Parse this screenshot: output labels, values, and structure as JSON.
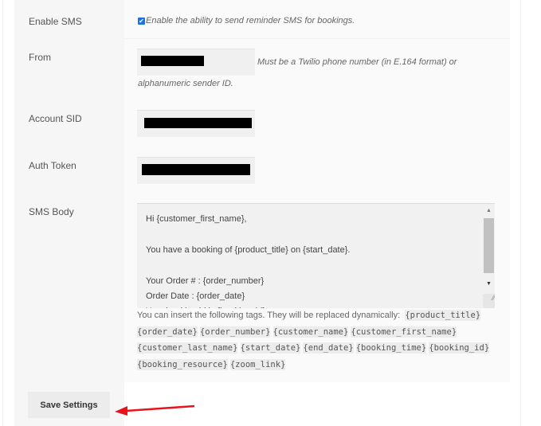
{
  "enable_sms": {
    "label": "Enable SMS",
    "checked": true,
    "description": "Enable the ability to send reminder SMS for bookings."
  },
  "from": {
    "label": "From",
    "hint_line1": "Must be a Twilio phone number (in E.164 format) or",
    "hint_line2": "alphanumeric sender ID."
  },
  "account_sid": {
    "label": "Account SID"
  },
  "auth_token": {
    "label": "Auth Token"
  },
  "sms_body": {
    "label": "SMS Body",
    "value": "Hi {customer_first_name},\n\nYou have a booking of {product_title} on {start_date}.\n\nYour Order # : {order_number}\nOrder Date : {order_date}\nYour booking id is {booking_id}",
    "tags_intro": "You can insert the following tags. They will be replaced dynamically:",
    "tags": [
      "{product_title}",
      "{order_date}",
      "{order_number}",
      "{customer_name}",
      "{customer_first_name}",
      "{customer_last_name}",
      "{start_date}",
      "{end_date}",
      "{booking_time}",
      "{booking_id}",
      "{booking_resource}",
      "{zoom_link}"
    ]
  },
  "save_button": {
    "label": "Save Settings"
  },
  "colors": {
    "annotation_arrow": "#e8141b",
    "checkbox": "#1a73e8"
  }
}
